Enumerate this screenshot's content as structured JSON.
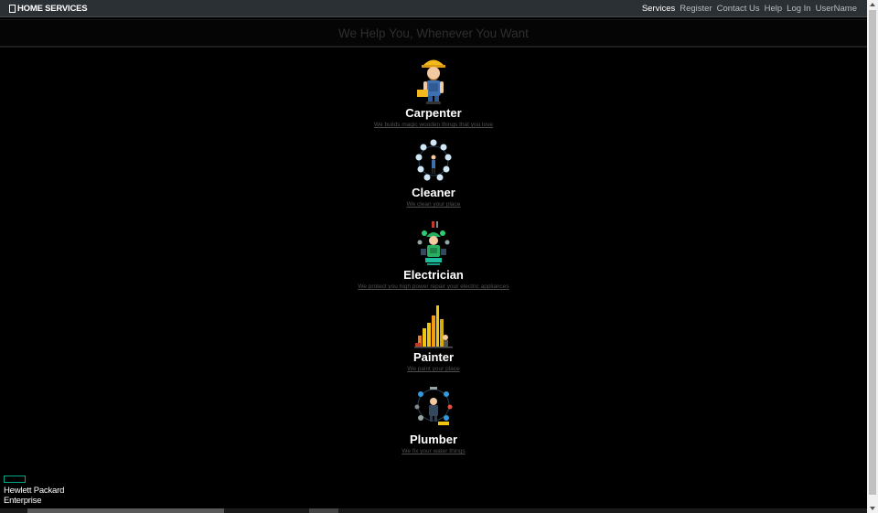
{
  "navbar": {
    "brand": "HOME SERVICES",
    "links": [
      {
        "label": "Services",
        "active": true
      },
      {
        "label": "Register"
      },
      {
        "label": "Contact Us"
      },
      {
        "label": "Help"
      },
      {
        "label": "Log In"
      },
      {
        "label": "UserName"
      }
    ]
  },
  "hero": {
    "title": "We Help You, Whenever You Want"
  },
  "services": [
    {
      "title": "Carpenter",
      "description": "We builds magic wooden things that you love",
      "icon": "carpenter-icon"
    },
    {
      "title": "Cleaner",
      "description": "We clean your place",
      "icon": "cleaner-icon"
    },
    {
      "title": "Electrician",
      "description": "We protect you high power repair your electric appliances",
      "icon": "electrician-icon"
    },
    {
      "title": "Painter",
      "description": "We paint your place",
      "icon": "painter-icon"
    },
    {
      "title": "Plumber",
      "description": "We fix your water things",
      "icon": "plumber-icon"
    }
  ],
  "footer": {
    "logo_line1": "Hewlett Packard",
    "logo_line2": "Enterprise"
  },
  "colors": {
    "navbar_bg": "#2b3035",
    "page_bg": "#000000",
    "hpe_green": "#01a982"
  }
}
